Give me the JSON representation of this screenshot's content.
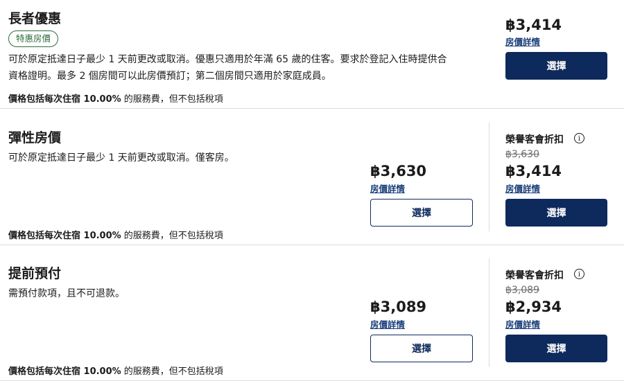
{
  "rates": [
    {
      "title": "長者優惠",
      "badge": "特惠房價",
      "description_line1": "可於原定抵達日子最少 1 天前更改或取消。優惠只適用於年滿 65 歲的住客。要求於登記入住時提供合",
      "description_line2": "資格證明。最多 2 個房間可以此房價預訂；第二個房間只適用於家庭成員。",
      "fee_prefix": "價格包括每次住宿 10.00%",
      "fee_suffix": " 的服務費，但不包括稅項",
      "price": "฿3,414",
      "details_label": "房價詳情",
      "select_label": "選擇"
    },
    {
      "title": "彈性房價",
      "description_line1": "可於原定抵達日子最少 1 天前更改或取消。僅客房。",
      "fee_prefix": "價格包括每次住宿 10.00%",
      "fee_suffix": " 的服務費，但不包括稅項",
      "price": "฿3,630",
      "details_label": "房價詳情",
      "select_label": "選擇",
      "member": {
        "label": "榮譽客會折扣",
        "original_price": "฿3,630",
        "price": "฿3,414",
        "details_label": "房價詳情",
        "select_label": "選擇"
      }
    },
    {
      "title": "提前預付",
      "description_line1": "需預付款項，且不可退款。",
      "fee_prefix": "價格包括每次住宿 10.00%",
      "fee_suffix": " 的服務費，但不包括稅項",
      "price": "฿3,089",
      "details_label": "房價詳情",
      "select_label": "選擇",
      "member": {
        "label": "榮譽客會折扣",
        "original_price": "฿3,089",
        "price": "฿2,934",
        "details_label": "房價詳情",
        "select_label": "選擇"
      }
    }
  ],
  "info_icon_glyph": "i",
  "colors": {
    "primary_navy": "#0e2a5c",
    "badge_green": "#2e6b3d",
    "link_blue": "#1a3f7a",
    "divider": "#dcdcdc"
  }
}
